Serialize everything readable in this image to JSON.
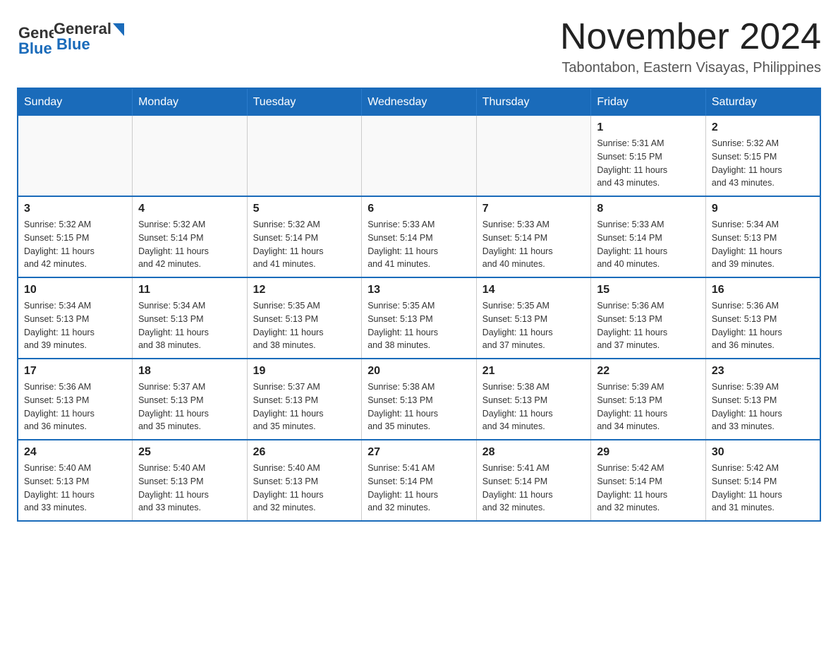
{
  "header": {
    "logo_general": "General",
    "logo_blue": "Blue",
    "month_title": "November 2024",
    "location": "Tabontabon, Eastern Visayas, Philippines"
  },
  "weekdays": [
    "Sunday",
    "Monday",
    "Tuesday",
    "Wednesday",
    "Thursday",
    "Friday",
    "Saturday"
  ],
  "weeks": [
    {
      "days": [
        {
          "number": "",
          "info": ""
        },
        {
          "number": "",
          "info": ""
        },
        {
          "number": "",
          "info": ""
        },
        {
          "number": "",
          "info": ""
        },
        {
          "number": "",
          "info": ""
        },
        {
          "number": "1",
          "info": "Sunrise: 5:31 AM\nSunset: 5:15 PM\nDaylight: 11 hours\nand 43 minutes."
        },
        {
          "number": "2",
          "info": "Sunrise: 5:32 AM\nSunset: 5:15 PM\nDaylight: 11 hours\nand 43 minutes."
        }
      ]
    },
    {
      "days": [
        {
          "number": "3",
          "info": "Sunrise: 5:32 AM\nSunset: 5:15 PM\nDaylight: 11 hours\nand 42 minutes."
        },
        {
          "number": "4",
          "info": "Sunrise: 5:32 AM\nSunset: 5:14 PM\nDaylight: 11 hours\nand 42 minutes."
        },
        {
          "number": "5",
          "info": "Sunrise: 5:32 AM\nSunset: 5:14 PM\nDaylight: 11 hours\nand 41 minutes."
        },
        {
          "number": "6",
          "info": "Sunrise: 5:33 AM\nSunset: 5:14 PM\nDaylight: 11 hours\nand 41 minutes."
        },
        {
          "number": "7",
          "info": "Sunrise: 5:33 AM\nSunset: 5:14 PM\nDaylight: 11 hours\nand 40 minutes."
        },
        {
          "number": "8",
          "info": "Sunrise: 5:33 AM\nSunset: 5:14 PM\nDaylight: 11 hours\nand 40 minutes."
        },
        {
          "number": "9",
          "info": "Sunrise: 5:34 AM\nSunset: 5:13 PM\nDaylight: 11 hours\nand 39 minutes."
        }
      ]
    },
    {
      "days": [
        {
          "number": "10",
          "info": "Sunrise: 5:34 AM\nSunset: 5:13 PM\nDaylight: 11 hours\nand 39 minutes."
        },
        {
          "number": "11",
          "info": "Sunrise: 5:34 AM\nSunset: 5:13 PM\nDaylight: 11 hours\nand 38 minutes."
        },
        {
          "number": "12",
          "info": "Sunrise: 5:35 AM\nSunset: 5:13 PM\nDaylight: 11 hours\nand 38 minutes."
        },
        {
          "number": "13",
          "info": "Sunrise: 5:35 AM\nSunset: 5:13 PM\nDaylight: 11 hours\nand 38 minutes."
        },
        {
          "number": "14",
          "info": "Sunrise: 5:35 AM\nSunset: 5:13 PM\nDaylight: 11 hours\nand 37 minutes."
        },
        {
          "number": "15",
          "info": "Sunrise: 5:36 AM\nSunset: 5:13 PM\nDaylight: 11 hours\nand 37 minutes."
        },
        {
          "number": "16",
          "info": "Sunrise: 5:36 AM\nSunset: 5:13 PM\nDaylight: 11 hours\nand 36 minutes."
        }
      ]
    },
    {
      "days": [
        {
          "number": "17",
          "info": "Sunrise: 5:36 AM\nSunset: 5:13 PM\nDaylight: 11 hours\nand 36 minutes."
        },
        {
          "number": "18",
          "info": "Sunrise: 5:37 AM\nSunset: 5:13 PM\nDaylight: 11 hours\nand 35 minutes."
        },
        {
          "number": "19",
          "info": "Sunrise: 5:37 AM\nSunset: 5:13 PM\nDaylight: 11 hours\nand 35 minutes."
        },
        {
          "number": "20",
          "info": "Sunrise: 5:38 AM\nSunset: 5:13 PM\nDaylight: 11 hours\nand 35 minutes."
        },
        {
          "number": "21",
          "info": "Sunrise: 5:38 AM\nSunset: 5:13 PM\nDaylight: 11 hours\nand 34 minutes."
        },
        {
          "number": "22",
          "info": "Sunrise: 5:39 AM\nSunset: 5:13 PM\nDaylight: 11 hours\nand 34 minutes."
        },
        {
          "number": "23",
          "info": "Sunrise: 5:39 AM\nSunset: 5:13 PM\nDaylight: 11 hours\nand 33 minutes."
        }
      ]
    },
    {
      "days": [
        {
          "number": "24",
          "info": "Sunrise: 5:40 AM\nSunset: 5:13 PM\nDaylight: 11 hours\nand 33 minutes."
        },
        {
          "number": "25",
          "info": "Sunrise: 5:40 AM\nSunset: 5:13 PM\nDaylight: 11 hours\nand 33 minutes."
        },
        {
          "number": "26",
          "info": "Sunrise: 5:40 AM\nSunset: 5:13 PM\nDaylight: 11 hours\nand 32 minutes."
        },
        {
          "number": "27",
          "info": "Sunrise: 5:41 AM\nSunset: 5:14 PM\nDaylight: 11 hours\nand 32 minutes."
        },
        {
          "number": "28",
          "info": "Sunrise: 5:41 AM\nSunset: 5:14 PM\nDaylight: 11 hours\nand 32 minutes."
        },
        {
          "number": "29",
          "info": "Sunrise: 5:42 AM\nSunset: 5:14 PM\nDaylight: 11 hours\nand 32 minutes."
        },
        {
          "number": "30",
          "info": "Sunrise: 5:42 AM\nSunset: 5:14 PM\nDaylight: 11 hours\nand 31 minutes."
        }
      ]
    }
  ]
}
